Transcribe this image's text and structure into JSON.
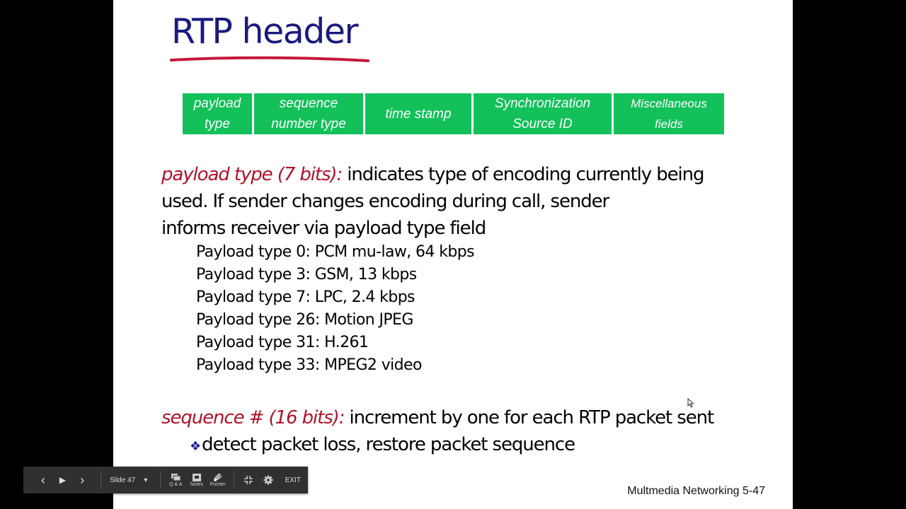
{
  "slide": {
    "title": "RTP header",
    "colors": {
      "title": "#1a1a80",
      "underline": "#c4183a",
      "header_cell": "#13c05a",
      "emphasis": "#b0122a",
      "bullet": "#1a1a9a"
    },
    "header_fields": [
      {
        "line1": "payload",
        "line2": "type"
      },
      {
        "line1": "sequence",
        "line2": "number type"
      },
      {
        "line1": "time stamp",
        "line2": ""
      },
      {
        "line1": "Synchronization",
        "line2": "Source ID"
      },
      {
        "line1": "Miscellaneous",
        "line2": "fields"
      }
    ],
    "payload_section": {
      "term": "payload type (7 bits):",
      "line1_rest": " indicates type of encoding currently being",
      "line2": "used.  If sender changes encoding during call, sender",
      "line3": "informs receiver via  payload type field",
      "types": [
        "Payload type 0: PCM mu-law, 64 kbps",
        "Payload type 3: GSM, 13 kbps",
        "Payload type 7: LPC, 2.4 kbps",
        "Payload type 26: Motion JPEG",
        "Payload type 31: H.261",
        "Payload type 33: MPEG2 video"
      ]
    },
    "sequence_section": {
      "term": "sequence # (16 bits):",
      "rest": " increment by one for each RTP packet sent",
      "bullet_glyph": "❖",
      "bullet": "detect packet loss, restore packet sequence"
    },
    "footer": "Multmedia Networking  5-47"
  },
  "toolbar": {
    "prev_icon": "‹",
    "play_icon": "▶",
    "next_icon": "›",
    "slide_selector": "Slide 47",
    "dropdown_icon": "▾",
    "qa_label": "Q & A",
    "notes_label": "Notes",
    "pointer_label": "Pointer",
    "exit_label": "EXIT"
  }
}
